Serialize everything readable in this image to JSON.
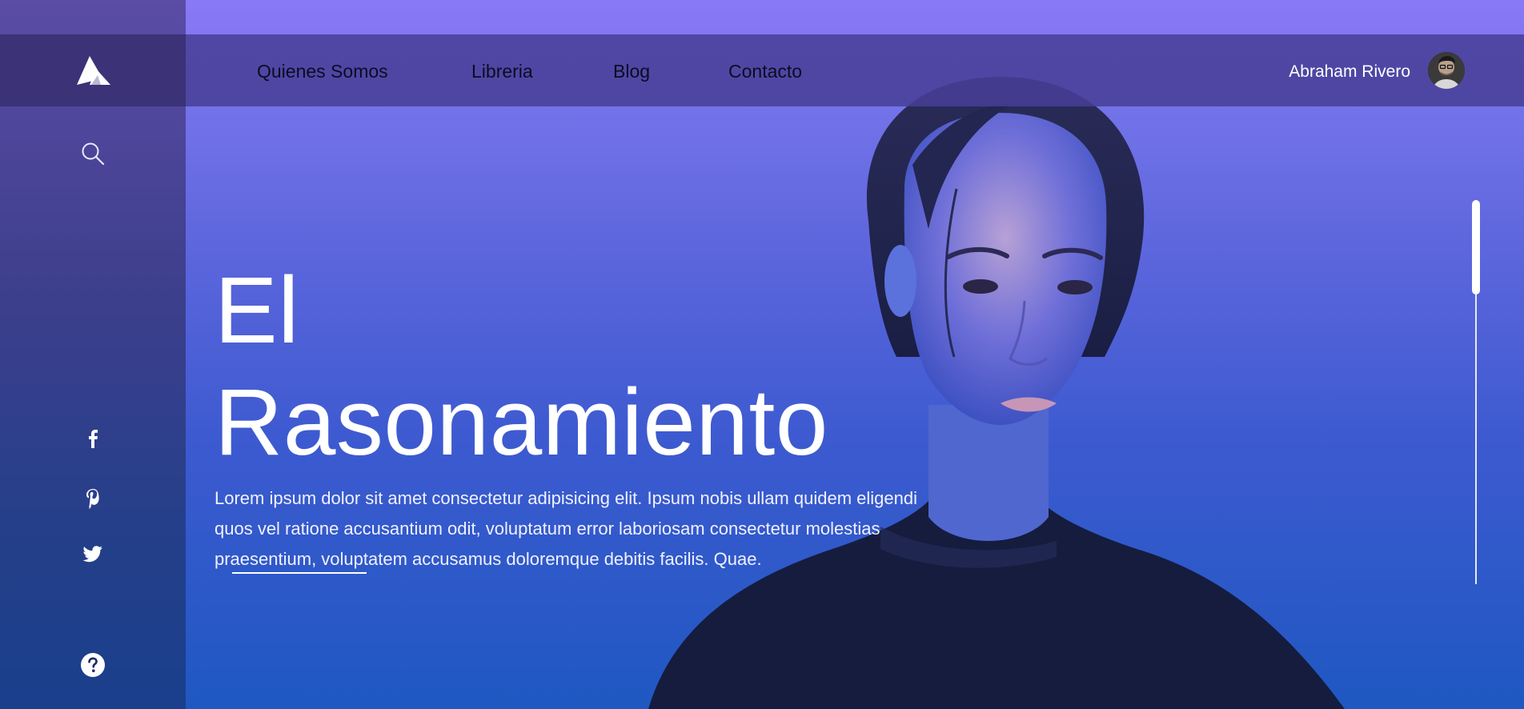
{
  "nav": {
    "links": [
      "Quienes Somos",
      "Libreria",
      "Blog",
      "Contacto"
    ]
  },
  "user": {
    "name": "Abraham Rivero"
  },
  "hero": {
    "title_line1": "El",
    "title_line2": "Rasonamiento",
    "description": "Lorem ipsum dolor sit amet consectetur adipisicing elit. Ipsum nobis ullam quidem eligendi quos vel ratione accusantium odit, voluptatum error laboriosam consectetur molestias praesentium, voluptatem accusamus doloremque debitis facilis. Quae."
  },
  "icons": {
    "logo": "logo-mountain-icon",
    "search": "search-icon",
    "facebook": "facebook-icon",
    "pinterest": "pinterest-icon",
    "twitter": "twitter-icon",
    "help": "help-icon"
  },
  "colors": {
    "sidebar": "#3e3f8d",
    "navbar": "#483e96",
    "nav_text": "#0c0b22",
    "background_top": "#8979f6",
    "background_bottom": "#1f58c2"
  }
}
